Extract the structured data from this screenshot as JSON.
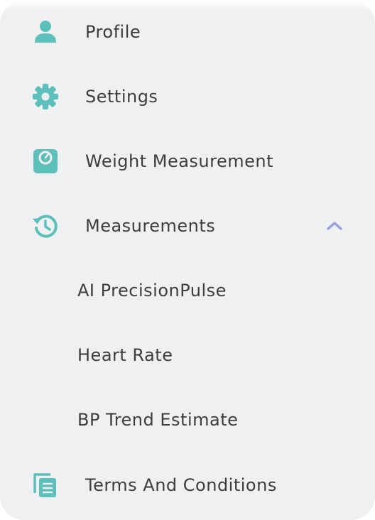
{
  "colors": {
    "accent": "#5cbfb9",
    "chevron": "#9aa0d8",
    "panel_bg": "#eef0f2",
    "text": "#3d3d3d"
  },
  "menu": {
    "items": [
      {
        "label": "Profile",
        "icon": "person-icon"
      },
      {
        "label": "Settings",
        "icon": "gear-icon"
      },
      {
        "label": "Weight Measurement",
        "icon": "scale-icon"
      },
      {
        "label": "Measurements",
        "icon": "history-icon",
        "expanded": true,
        "toggle_icon": "chevron-up-icon"
      }
    ],
    "subitems": [
      {
        "label": "AI PrecisionPulse"
      },
      {
        "label": "Heart Rate"
      },
      {
        "label": "BP Trend Estimate"
      }
    ],
    "footer_item": {
      "label": "Terms And Conditions",
      "icon": "document-icon"
    }
  }
}
